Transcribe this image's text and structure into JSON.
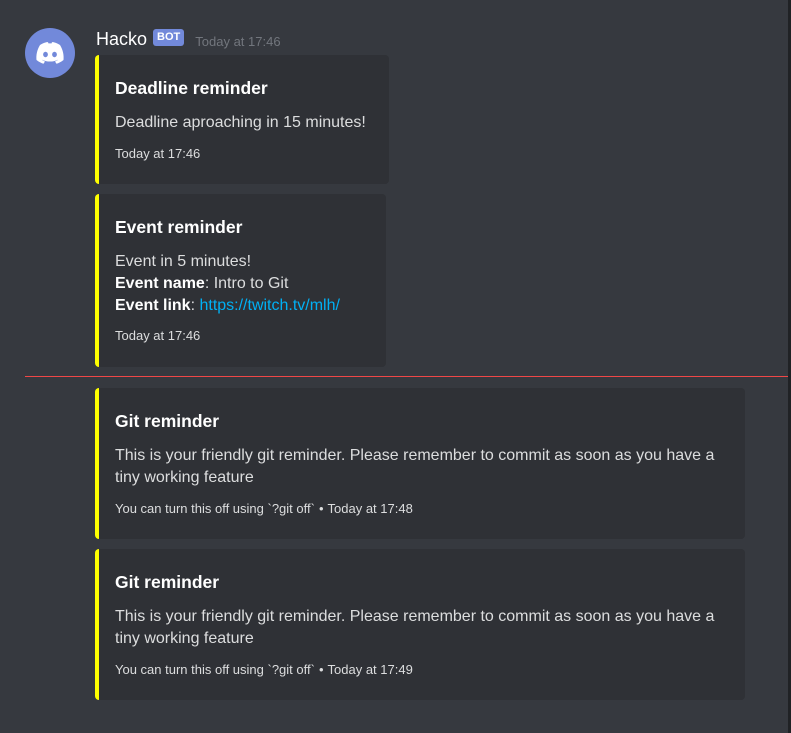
{
  "message": {
    "username": "Hacko",
    "bot_tag": "BOT",
    "timestamp": "Today at 17:46",
    "accent_color": "#ffff00",
    "link_color": "#00b0f4",
    "divider_color": "#f04747",
    "avatar_icon": "discord-logo-icon"
  },
  "embeds": [
    {
      "title": "Deadline reminder",
      "description": "Deadline aproaching in 15 minutes!",
      "footer": "Today at 17:46"
    },
    {
      "title": "Event reminder",
      "description": "Event in 5 minutes!",
      "event_name_label": "Event name",
      "event_name_value": ": Intro to Git",
      "event_link_label": "Event link",
      "event_link_sep": ": ",
      "event_link_value": "https://twitch.tv/mlh/",
      "footer": "Today at 17:46"
    },
    {
      "title": "Git reminder",
      "description": "This is your friendly git reminder. Please remember to commit as soon as you have a tiny working feature",
      "footer_text": "You can turn this off using `?git off`",
      "footer_sep": "•",
      "footer_time": "Today at 17:48"
    },
    {
      "title": "Git reminder",
      "description": "This is your friendly git reminder. Please remember to commit as soon as you have a tiny working feature",
      "footer_text": "You can turn this off using `?git off`",
      "footer_sep": "•",
      "footer_time": "Today at 17:49"
    }
  ]
}
